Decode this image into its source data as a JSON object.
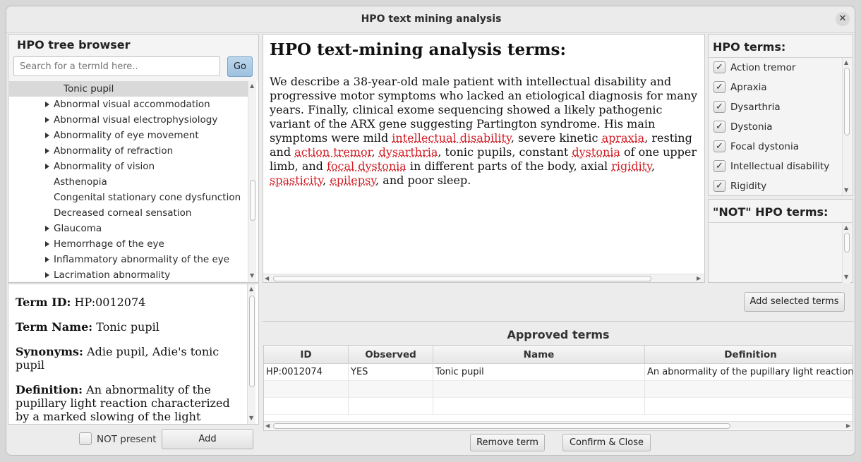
{
  "window": {
    "title": "HPO text mining analysis",
    "close_glyph": "✕"
  },
  "tree_browser": {
    "heading": "HPO tree browser",
    "search_placeholder": "Search for a termId here..",
    "go_label": "Go",
    "selected": "Tonic pupil",
    "items": [
      {
        "label": "Abnormal visual accommodation",
        "expandable": true
      },
      {
        "label": "Abnormal visual electrophysiology",
        "expandable": true
      },
      {
        "label": "Abnormality of eye movement",
        "expandable": true
      },
      {
        "label": "Abnormality of refraction",
        "expandable": true
      },
      {
        "label": "Abnormality of vision",
        "expandable": true
      },
      {
        "label": "Asthenopia",
        "expandable": false
      },
      {
        "label": "Congenital stationary cone dysfunction",
        "expandable": false
      },
      {
        "label": "Decreased corneal sensation",
        "expandable": false
      },
      {
        "label": "Glaucoma",
        "expandable": true
      },
      {
        "label": "Hemorrhage of the eye",
        "expandable": true
      },
      {
        "label": "Inflammatory abnormality of the eye",
        "expandable": true
      },
      {
        "label": "Lacrimation abnormality",
        "expandable": true
      }
    ]
  },
  "term_detail": {
    "id_label": "Term ID:",
    "id_value": "HP:0012074",
    "name_label": "Term Name:",
    "name_value": "Tonic pupil",
    "synonyms_label": "Synonyms:",
    "synonyms_value": "Adie pupil, Adie's tonic pupil",
    "definition_label": "Definition:",
    "definition_value": "An abnormality of the pupillary light reaction characterized by a marked slowing of the light reaction of"
  },
  "footer_left": {
    "not_present_label": "NOT present",
    "add_label": "Add"
  },
  "analysis": {
    "heading": "HPO text-mining analysis terms:",
    "segments": [
      {
        "t": "We describe a 38-year-old male patient with intellectual disability and progressive motor symptoms who lacked an etiological diagnosis for many years. Finally, clinical exome sequencing showed a likely pathogenic variant of the ARX gene suggesting Partington syndrome. His main symptoms were mild ",
        "hl": false
      },
      {
        "t": "intellectual disability",
        "hl": true
      },
      {
        "t": ", severe kinetic ",
        "hl": false
      },
      {
        "t": "apraxia",
        "hl": true
      },
      {
        "t": ", resting and ",
        "hl": false
      },
      {
        "t": "action tremor",
        "hl": true
      },
      {
        "t": ", ",
        "hl": false
      },
      {
        "t": "dysarthria",
        "hl": true
      },
      {
        "t": ", tonic pupils, constant ",
        "hl": false
      },
      {
        "t": "dystonia",
        "hl": true
      },
      {
        "t": " of one upper limb, and ",
        "hl": false
      },
      {
        "t": "focal dystonia",
        "hl": true
      },
      {
        "t": " in different parts of the body, axial ",
        "hl": false
      },
      {
        "t": "rigidity",
        "hl": true
      },
      {
        "t": ", ",
        "hl": false
      },
      {
        "t": "spasticity",
        "hl": true
      },
      {
        "t": ", ",
        "hl": false
      },
      {
        "t": "epilepsy",
        "hl": true
      },
      {
        "t": ", and poor sleep.",
        "hl": false
      }
    ]
  },
  "hpo_terms": {
    "heading": "HPO terms:",
    "items": [
      {
        "label": "Action tremor",
        "checked": true
      },
      {
        "label": "Apraxia",
        "checked": true
      },
      {
        "label": "Dysarthria",
        "checked": true
      },
      {
        "label": "Dystonia",
        "checked": true
      },
      {
        "label": "Focal dystonia",
        "checked": true
      },
      {
        "label": "Intellectual disability",
        "checked": true
      },
      {
        "label": "Rigidity",
        "checked": true
      }
    ]
  },
  "not_terms": {
    "heading": "\"NOT\" HPO terms:"
  },
  "add_selected_label": "Add selected terms",
  "approved": {
    "heading": "Approved terms",
    "columns": [
      "ID",
      "Observed",
      "Name",
      "Definition"
    ],
    "rows": [
      [
        "HP:0012074",
        "YES",
        "Tonic pupil",
        "An abnormality of the pupillary light reaction"
      ]
    ]
  },
  "footer_right": {
    "remove_label": "Remove term",
    "confirm_label": "Confirm & Close"
  }
}
